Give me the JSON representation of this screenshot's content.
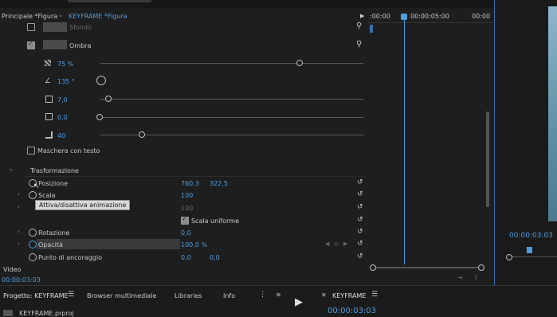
{
  "tabs": {
    "principale": "Principale *Figura",
    "keyframe": "KEYFRAME *Figura"
  },
  "timeline": {
    "t0": ":00:00",
    "t1": "00:00:05:00",
    "t2": "00:00"
  },
  "effects": {
    "sfondo": "Sfondo",
    "ombra": "Ombra",
    "opacity_val": "75 %",
    "angle_val": "135 °",
    "distance_val": "7,0",
    "size_val": "0,0",
    "blur_val": "40",
    "mask_text": "Maschera con testo"
  },
  "transform": {
    "section": "Trasformazione",
    "posizione_label": "Posizione",
    "pos_x": "760,3",
    "pos_y": "322,5",
    "scala_label": "Scala",
    "scala_val": "100",
    "scala_larghezza_val": "100",
    "tooltip": "Attiva/disattiva animazione",
    "uniform": "Scala uniforme",
    "rotazione_label": "Rotazione",
    "rotazione_val": "0,0",
    "opacita_label": "Opacità",
    "opacita_val": "100,0 %",
    "ancoraggio_label": "Punto di ancoraggio",
    "anc_x": "0,0",
    "anc_y": "0,0"
  },
  "video_section": "Video",
  "current_time": "00:00:03:03",
  "program_time": "00:00:03:03",
  "bottom": {
    "progetto_tab": "Progetto: KEYFRAME",
    "browser_tab": "Browser multimediale",
    "libraries_tab": "Libraries",
    "info_tab": "Info",
    "more": "»",
    "seq_name": "KEYFRAME",
    "seq_time": "00:00:03:03",
    "project_file": "KEYFRAME.prproj"
  },
  "colors": {
    "accent": "#4f9de0",
    "panel": "#1e1e1e"
  }
}
